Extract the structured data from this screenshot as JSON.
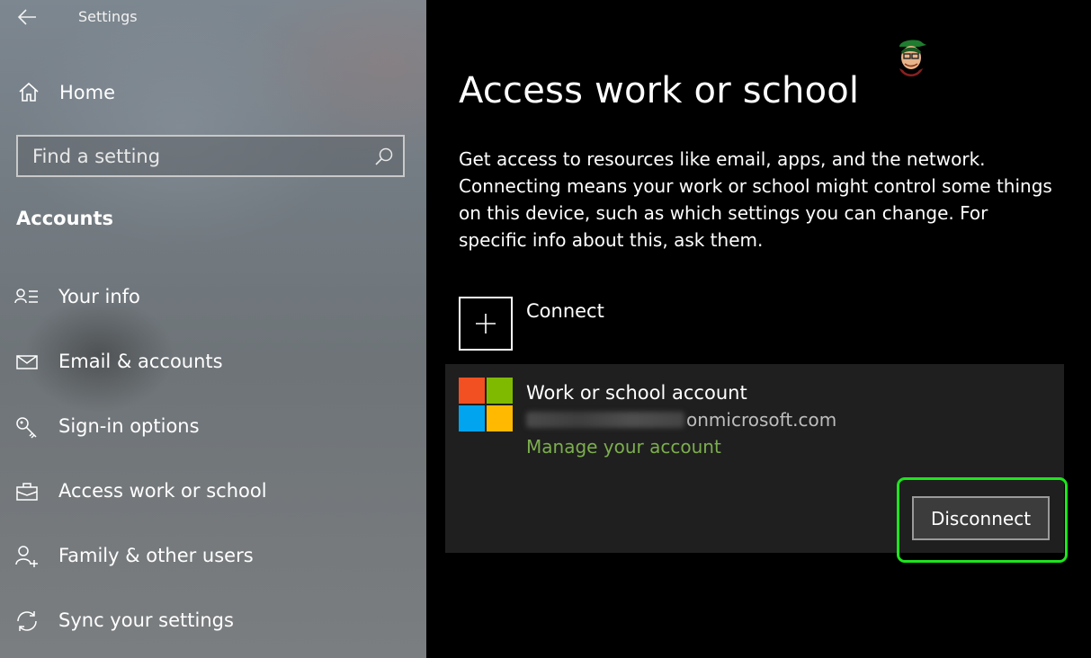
{
  "window": {
    "title": "Settings"
  },
  "sidebar": {
    "home_label": "Home",
    "search_placeholder": "Find a setting",
    "section_title": "Accounts",
    "items": [
      {
        "label": "Your info",
        "icon": "person-list-icon"
      },
      {
        "label": "Email & accounts",
        "icon": "mail-icon"
      },
      {
        "label": "Sign-in options",
        "icon": "key-icon"
      },
      {
        "label": "Access work or school",
        "icon": "briefcase-icon"
      },
      {
        "label": "Family & other users",
        "icon": "person-add-icon"
      },
      {
        "label": "Sync your settings",
        "icon": "sync-icon"
      }
    ]
  },
  "main": {
    "title": "Access work or school",
    "description": "Get access to resources like email, apps, and the network. Connecting means your work or school might control some things on this device, such as which settings you can change. For specific info about this, ask them.",
    "connect_label": "Connect",
    "account": {
      "type": "Work or school account",
      "email_domain": "onmicrosoft.com",
      "manage_link": "Manage your account",
      "disconnect_label": "Disconnect"
    }
  },
  "colors": {
    "link": "#7cae4e",
    "highlight": "#1ee41e",
    "ms_red": "#f25022",
    "ms_green": "#7fba00",
    "ms_blue": "#00a4ef",
    "ms_yellow": "#ffb900"
  }
}
